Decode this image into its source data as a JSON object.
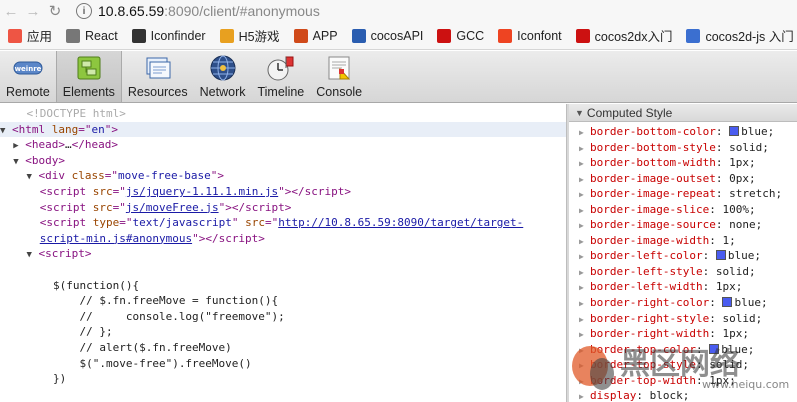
{
  "browser": {
    "url_host": "10.8.65.59",
    "url_rest": ":8090/client/#anonymous",
    "bookmarks": [
      {
        "label": "应用",
        "icon": "apps-grid-icon",
        "color": "#e54"
      },
      {
        "label": "React",
        "icon": "document-icon",
        "color": "#777"
      },
      {
        "label": "Iconfinder",
        "icon": "iconfinder-icon",
        "color": "#333"
      },
      {
        "label": "H5游戏",
        "icon": "h5-icon",
        "color": "#e8a020"
      },
      {
        "label": "APP",
        "icon": "app-icon",
        "color": "#d04a1a"
      },
      {
        "label": "cocosAPI",
        "icon": "cocos-icon",
        "color": "#2a5db0"
      },
      {
        "label": "GCC",
        "icon": "gcc-icon",
        "color": "#cc1111"
      },
      {
        "label": "Iconfont",
        "icon": "iconfont-icon",
        "color": "#ee4422"
      },
      {
        "label": "cocos2dx入门",
        "icon": "cocos2dx-icon",
        "color": "#cc1111"
      },
      {
        "label": "cocos2d-js 入门",
        "icon": "cocos2djs-icon",
        "color": "#3b6fd0"
      }
    ]
  },
  "toolbar": {
    "items": [
      {
        "label": "Remote",
        "icon": "weinre-icon"
      },
      {
        "label": "Elements",
        "icon": "elements-icon"
      },
      {
        "label": "Resources",
        "icon": "resources-icon"
      },
      {
        "label": "Network",
        "icon": "network-icon"
      },
      {
        "label": "Timeline",
        "icon": "timeline-icon"
      },
      {
        "label": "Console",
        "icon": "console-icon"
      }
    ],
    "weinre_text": "weinre"
  },
  "elements": {
    "doctype": "<!DOCTYPE html>",
    "html_lang": "en",
    "div_class": "move-free-base",
    "script1_src": "js/jquery-1.11.1.min.js",
    "script2_src": "js/moveFree.js",
    "script3_type": "text/javascript",
    "script3_src_a": "http://10.8.65.59:8090/target/target-",
    "script3_src_b": "script-min.js#anonymous",
    "js_lines": [
      "$(function(){",
      "    // $.fn.freeMove = function(){",
      "    //     console.log(\"freemove\");",
      "    // };",
      "    // alert($.fn.freeMove)",
      "    $(\".move-free\").freeMove()",
      "})"
    ]
  },
  "computed": {
    "title": "Computed Style",
    "props": [
      {
        "name": "border-bottom-color",
        "value": "blue;",
        "swatch": true
      },
      {
        "name": "border-bottom-style",
        "value": "solid;"
      },
      {
        "name": "border-bottom-width",
        "value": "1px;"
      },
      {
        "name": "border-image-outset",
        "value": "0px;"
      },
      {
        "name": "border-image-repeat",
        "value": "stretch;"
      },
      {
        "name": "border-image-slice",
        "value": "100%;"
      },
      {
        "name": "border-image-source",
        "value": "none;"
      },
      {
        "name": "border-image-width",
        "value": "1;"
      },
      {
        "name": "border-left-color",
        "value": "blue;",
        "swatch": true
      },
      {
        "name": "border-left-style",
        "value": "solid;"
      },
      {
        "name": "border-left-width",
        "value": "1px;"
      },
      {
        "name": "border-right-color",
        "value": "blue;",
        "swatch": true
      },
      {
        "name": "border-right-style",
        "value": "solid;"
      },
      {
        "name": "border-right-width",
        "value": "1px;"
      },
      {
        "name": "border-top-color",
        "value": "blue;",
        "swatch": true
      },
      {
        "name": "border-top-style",
        "value": "solid;"
      },
      {
        "name": "border-top-width",
        "value": "1px;"
      },
      {
        "name": "display",
        "value": "block;"
      }
    ]
  },
  "watermark": {
    "text_cn": "黑区网络",
    "text_url": "www.heiqu.com"
  }
}
